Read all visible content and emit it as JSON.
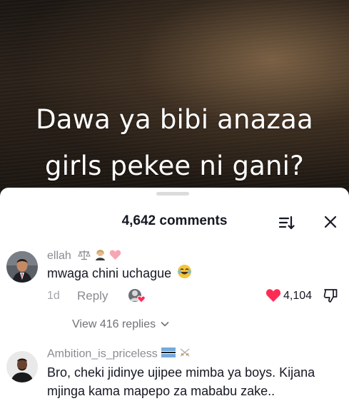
{
  "video": {
    "caption_line1": "Dawa ya bibi anazaa",
    "caption_line2": "girls pekee ni gani?"
  },
  "sheet": {
    "comment_count": "4,642 comments",
    "sort_icon": "sort-icon",
    "close_icon": "close-icon"
  },
  "comments": [
    {
      "username": "ellah",
      "username_badges": [
        "scales-emoji",
        "woman-judge-emoji",
        "pink-heart-emoji"
      ],
      "text": "mwaga chini uchague",
      "text_emoji": "tears-of-joy-emoji",
      "date": "1d",
      "reply_label": "Reply",
      "creator_liked_icon": "creator-heart-avatar-icon",
      "like_icon": "filled-heart-icon",
      "like_count": "4,104",
      "dislike_icon": "thumbs-down-icon",
      "view_replies": "View 416 replies"
    },
    {
      "username": "Ambition_is_priceless",
      "username_badges": [
        "botswana-flag-emoji",
        "crossed-swords-emoji"
      ],
      "text": "Bro, cheki jidinye ujipee mimba ya boys. Kijana mjinga kama mapepo za mababu zake.."
    }
  ],
  "colors": {
    "like_red": "#fe2c55",
    "secondary_text": "#8a8b91",
    "primary_text": "#161823"
  }
}
